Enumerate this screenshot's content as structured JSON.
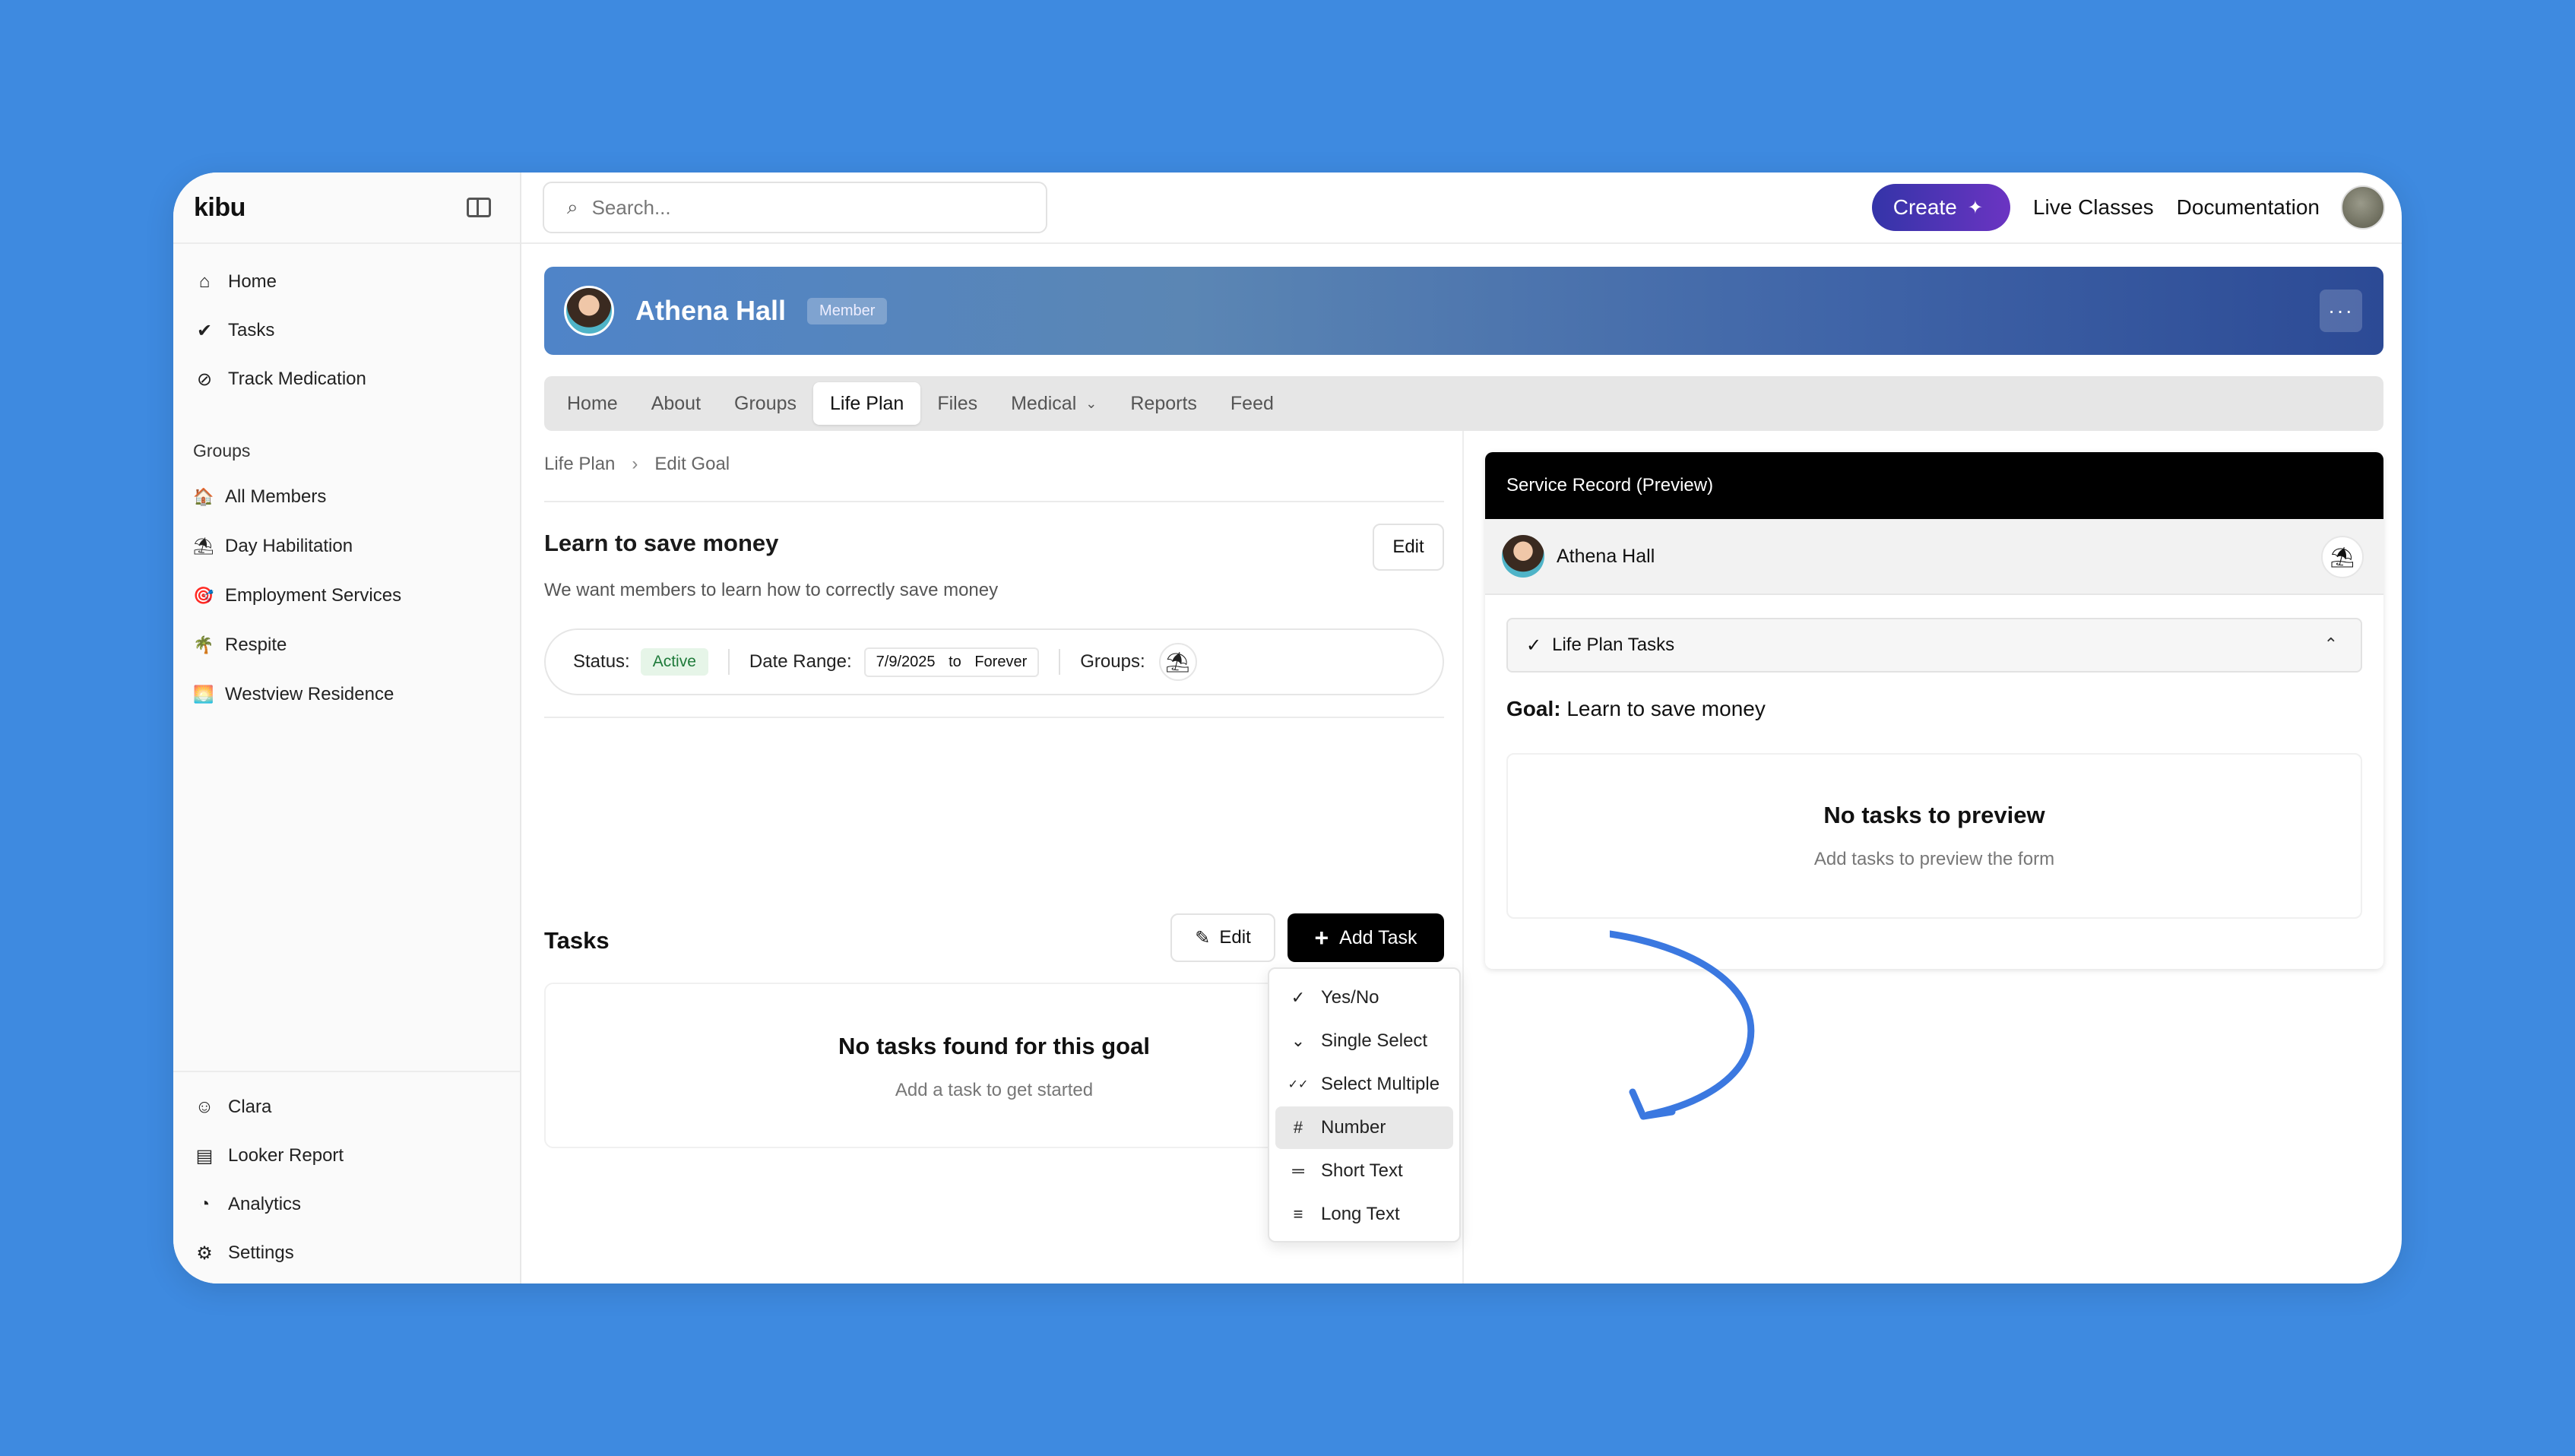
{
  "sidebar": {
    "brand": "kibu",
    "nav": [
      {
        "label": "Home"
      },
      {
        "label": "Tasks"
      },
      {
        "label": "Track Medication"
      }
    ],
    "groups_label": "Groups",
    "groups": [
      {
        "label": "All Members",
        "emoji": "🏠"
      },
      {
        "label": "Day Habilitation",
        "emoji": "⛱"
      },
      {
        "label": "Employment Services",
        "emoji": "🎯"
      },
      {
        "label": "Respite",
        "emoji": "🌴"
      },
      {
        "label": "Westview Residence",
        "emoji": "🌅"
      }
    ],
    "bottom": [
      {
        "label": "Clara"
      },
      {
        "label": "Looker Report"
      },
      {
        "label": "Analytics"
      },
      {
        "label": "Settings"
      }
    ]
  },
  "topbar": {
    "search_placeholder": "Search...",
    "create_label": "Create",
    "live_classes": "Live Classes",
    "documentation": "Documentation"
  },
  "member": {
    "name": "Athena Hall",
    "badge": "Member",
    "menu": "···"
  },
  "tabs": [
    {
      "label": "Home"
    },
    {
      "label": "About"
    },
    {
      "label": "Groups"
    },
    {
      "label": "Life Plan",
      "active": true
    },
    {
      "label": "Files"
    },
    {
      "label": "Medical"
    },
    {
      "label": "Reports"
    },
    {
      "label": "Feed"
    }
  ],
  "breadcrumb": [
    "Life Plan",
    "Edit Goal"
  ],
  "goal": {
    "title": "Learn to save money",
    "description": "We want members to learn how to correctly save money",
    "edit_label": "Edit",
    "status_label": "Status:",
    "status_value": "Active",
    "date_range_label": "Date Range:",
    "date_start": "7/9/2025",
    "date_to": "to",
    "date_end": "Forever",
    "groups_label": "Groups:",
    "group_emoji": "⛱"
  },
  "tasks": {
    "title": "Tasks",
    "edit_label": "Edit",
    "add_label": "Add Task",
    "empty_title": "No tasks found for this goal",
    "empty_sub": "Add a task to get started"
  },
  "task_menu": [
    {
      "label": "Yes/No",
      "icon": "check-circle-icon",
      "glyph": "✓"
    },
    {
      "label": "Single Select",
      "icon": "chevron-down-icon",
      "glyph": "⌄"
    },
    {
      "label": "Select Multiple",
      "icon": "double-check-icon",
      "glyph": "✓✓"
    },
    {
      "label": "Number",
      "icon": "hash-icon",
      "glyph": "#",
      "highlighted": true
    },
    {
      "label": "Short Text",
      "icon": "short-text-icon",
      "glyph": "═"
    },
    {
      "label": "Long Text",
      "icon": "long-text-icon",
      "glyph": "≡"
    }
  ],
  "preview": {
    "header": "Service Record (Preview)",
    "user": "Athena Hall",
    "section": "Life Plan Tasks",
    "goal_label": "Goal:",
    "goal_value": "Learn to save money",
    "empty_title": "No tasks to preview",
    "empty_sub": "Add tasks to preview the form"
  },
  "colors": {
    "background": "#3e8ae0",
    "create_gradient_start": "#3434a8",
    "create_gradient_end": "#6b34c2",
    "fab": "#2e63e6",
    "status_active": "#1e7a3a"
  }
}
